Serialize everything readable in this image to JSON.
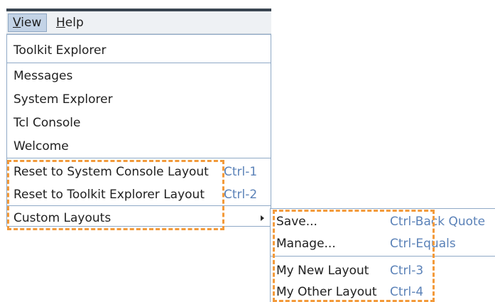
{
  "menubar": {
    "view": {
      "mnemonic": "V",
      "rest": "iew"
    },
    "help": {
      "mnemonic": "H",
      "rest": "elp"
    }
  },
  "view_menu": {
    "toolkit_explorer": "Toolkit Explorer",
    "messages": "Messages",
    "system_explorer": "System Explorer",
    "tcl_console": "Tcl Console",
    "welcome": "Welcome",
    "reset_system_console": {
      "label": "Reset to System Console Layout",
      "accel": "Ctrl-1"
    },
    "reset_toolkit_explorer": {
      "label": "Reset to Toolkit Explorer Layout",
      "accel": "Ctrl-2"
    },
    "custom_layouts": "Custom Layouts"
  },
  "custom_layouts_menu": {
    "save": {
      "label": "Save...",
      "accel": "Ctrl-Back Quote"
    },
    "manage": {
      "label": "Manage...",
      "accel": "Ctrl-Equals"
    },
    "my_new_layout": {
      "label": "My New Layout",
      "accel": "Ctrl-3"
    },
    "my_other_layout": {
      "label": "My Other Layout",
      "accel": "Ctrl-4"
    }
  },
  "colors": {
    "accelerator_text": "#5b82b8",
    "highlight_dashes": "#f39a3a",
    "menu_border": "#8fa9c6",
    "selected_menu_bg": "#c3d3e6"
  }
}
